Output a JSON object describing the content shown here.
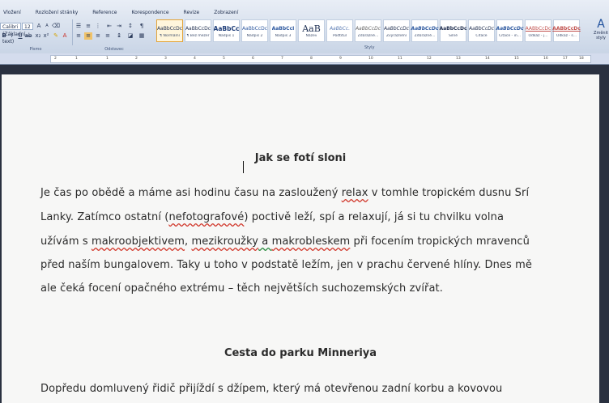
{
  "ribbon": {
    "tabs": [
      "Vložení",
      "Rozložení stránky",
      "Reference",
      "Korespondence",
      "Revize",
      "Zobrazení"
    ],
    "font_name": "Calibri (Základní text)",
    "font_size": "12",
    "group_font": "Písmo",
    "group_paragraph": "Odstavec",
    "group_styles": "Styly",
    "change_styles": "Změnit styly",
    "styles": [
      {
        "sample": "AaBbCcDc",
        "name": "¶ Normální"
      },
      {
        "sample": "AaBbCcDc",
        "name": "¶ Bez mezer"
      },
      {
        "sample": "AaBbCc",
        "name": "Nadpis 1"
      },
      {
        "sample": "AaBbCcDc",
        "name": "Nadpis 2"
      },
      {
        "sample": "AaBbCcI",
        "name": "Nadpis 3"
      },
      {
        "sample": "AaB",
        "name": "Název"
      },
      {
        "sample": "AaBbCc.",
        "name": "Podtitul"
      },
      {
        "sample": "AaBbCcDc",
        "name": "Zdůrazně..."
      },
      {
        "sample": "AaBbCcDc",
        "name": "Zvýraznění"
      },
      {
        "sample": "AaBbCcDc",
        "name": "Zdůrazně..."
      },
      {
        "sample": "AaBbCcDc",
        "name": "Silné"
      },
      {
        "sample": "AaBbCcDc",
        "name": "Citace"
      },
      {
        "sample": "AaBbCcDc",
        "name": "Citace - in..."
      },
      {
        "sample": "AABbCcDc",
        "name": "Odkaz - j..."
      },
      {
        "sample": "AABbCcDc",
        "name": "Odkaz - s..."
      }
    ]
  },
  "ruler": {
    "ticks": [
      "1",
      "2",
      "1",
      "2",
      "3",
      "4",
      "5",
      "6",
      "7",
      "8",
      "9",
      "10",
      "11",
      "12",
      "13",
      "14",
      "15",
      "16",
      "17",
      "18"
    ]
  },
  "document": {
    "title": "Jak se fotí sloni",
    "paragraph1": {
      "line1_a": "Je čas po obědě a máme asi hodinu času na zasloužený ",
      "line1_b": "relax",
      "line1_c": " v tomhle tropickém dusnu Srí",
      "line2_a": "Lanky. Zatímco ostatní (",
      "line2_b": "nefotografové",
      "line2_c": ") poctivě leží, spí a relaxují, já si tu chvilku volna",
      "line3_a": "užívám s ",
      "line3_b": "makroobjektivem",
      "line3_c": ", ",
      "line3_d": "mezikroužky",
      "line3_e": " a ",
      "line3_f": "makrobleskem",
      "line3_g": " při focením tropických mravenců",
      "line4": "před naším bungalovem. Taky u toho v podstatě ležím, jen v prachu červené hlíny.  Dnes mě",
      "line5": "ale čeká focení opačného extrému – těch největších suchozemských zvířat."
    },
    "subtitle": "Cesta do parku Minneriya",
    "paragraph2": {
      "line1": "Dopředu domluvený řidič přijíždí s džípem, který má otevřenou zadní korbu a kovovou"
    }
  }
}
